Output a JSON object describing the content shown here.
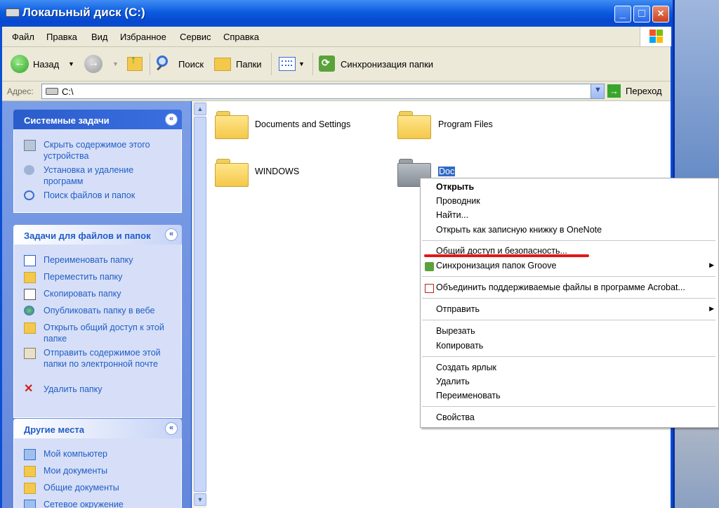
{
  "window": {
    "title": "Локальный диск (C:)"
  },
  "menubar": [
    "Файл",
    "Правка",
    "Вид",
    "Избранное",
    "Сервис",
    "Справка"
  ],
  "toolbar": {
    "back": "Назад",
    "search": "Поиск",
    "folders": "Папки",
    "sync": "Синхронизация папки"
  },
  "address": {
    "label": "Адрес:",
    "value": "C:\\",
    "go": "Переход"
  },
  "panels": {
    "system": {
      "title": "Системные задачи",
      "items": [
        "Скрыть содержимое этого устройства",
        "Установка и удаление программ",
        "Поиск файлов и папок"
      ]
    },
    "file": {
      "title": "Задачи для файлов и папок",
      "items": [
        "Переименовать папку",
        "Переместить папку",
        "Скопировать папку",
        "Опубликовать папку в вебе",
        "Открыть общий доступ к этой папке",
        "Отправить содержимое этой папки по электронной почте",
        "Удалить папку"
      ]
    },
    "other": {
      "title": "Другие места",
      "items": [
        "Мой компьютер",
        "Мои документы",
        "Общие документы",
        "Сетевое окружение"
      ]
    }
  },
  "folders": [
    "Documents and Settings",
    "Program Files",
    "WINDOWS",
    "Doc"
  ],
  "context_menu": [
    "Открыть",
    "Проводник",
    "Найти...",
    "Открыть как записную книжку в OneNote",
    "Общий доступ и безопасность...",
    "Синхронизация папок Groove",
    "Объединить поддерживаемые файлы в программе Acrobat...",
    "Отправить",
    "Вырезать",
    "Копировать",
    "Создать ярлык",
    "Удалить",
    "Переименовать",
    "Свойства"
  ],
  "colors": {
    "title_bar": "#0a4fd4",
    "task_link": "#215dc6",
    "selection": "#316ac5",
    "annotation": "#e01818"
  }
}
